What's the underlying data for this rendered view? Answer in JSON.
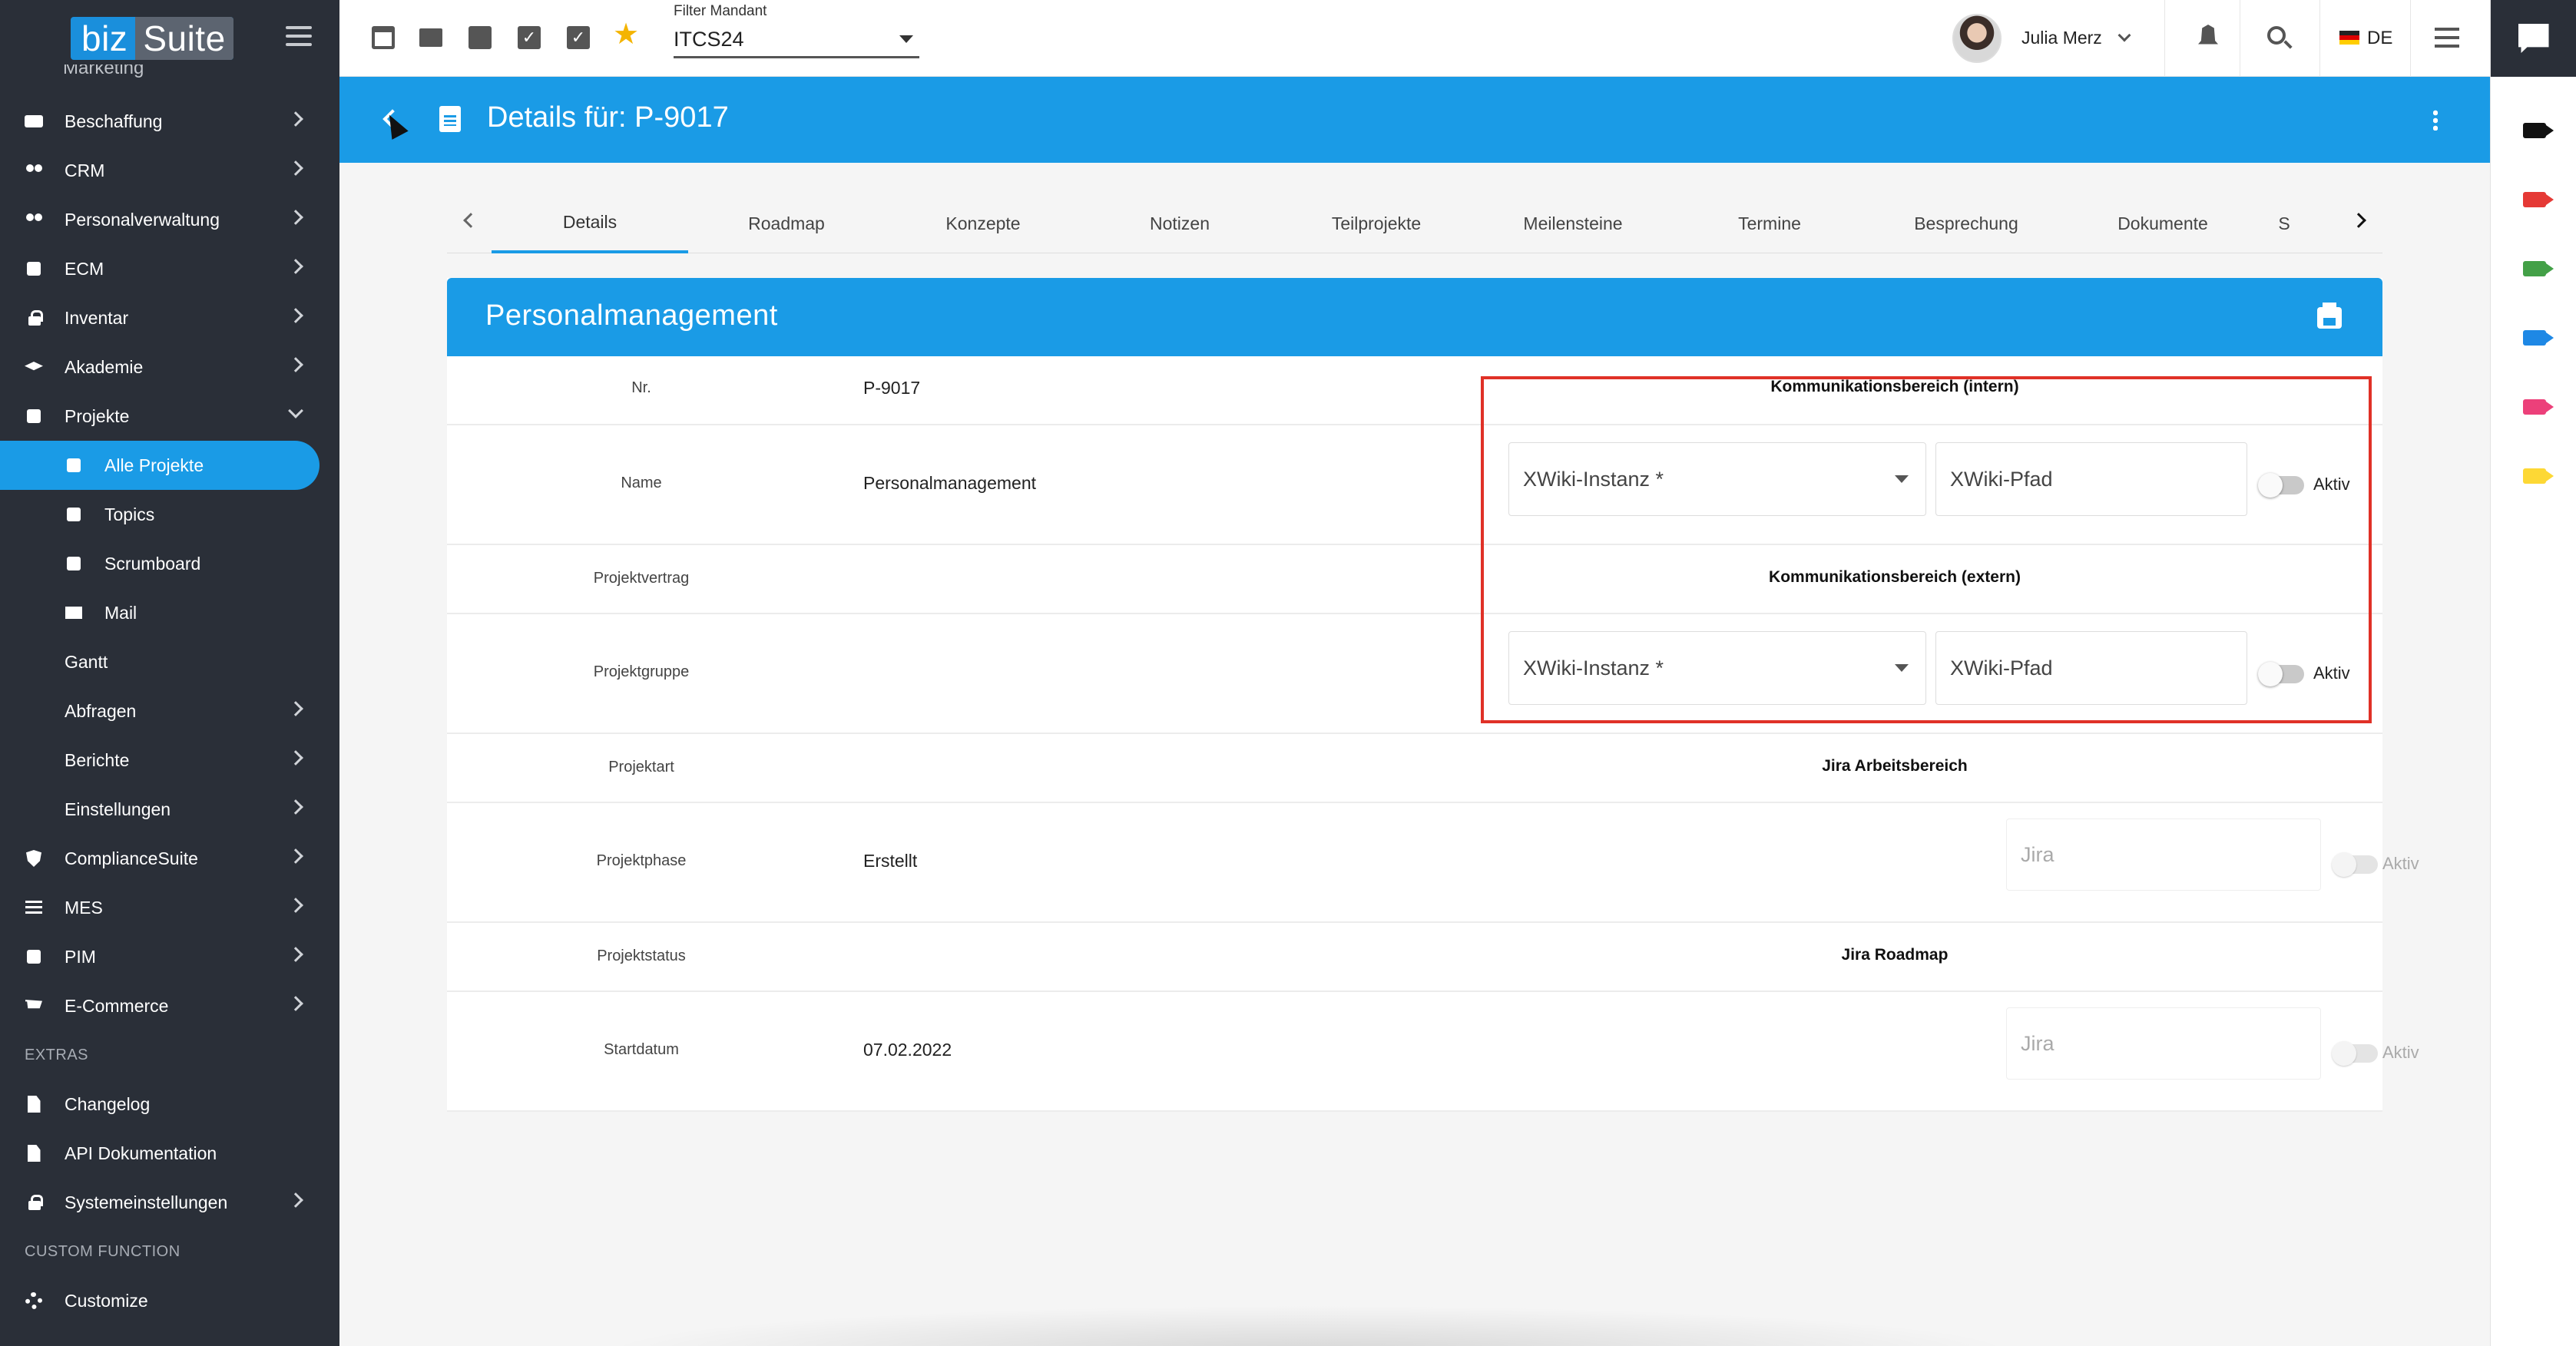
{
  "app": {
    "logo_part1": "biz",
    "logo_part2": "Suite"
  },
  "sidebar": {
    "cut_item": "Marketing",
    "items": [
      {
        "label": "Beschaffung",
        "icon": "truck-icon",
        "chevron": "right"
      },
      {
        "label": "CRM",
        "icon": "people-icon",
        "chevron": "right"
      },
      {
        "label": "Personalverwaltung",
        "icon": "people-icon",
        "chevron": "right"
      },
      {
        "label": "ECM",
        "icon": "archive-icon",
        "chevron": "right"
      },
      {
        "label": "Inventar",
        "icon": "lock-icon",
        "chevron": "right"
      },
      {
        "label": "Akademie",
        "icon": "graduation-cap-icon",
        "chevron": "right"
      },
      {
        "label": "Projekte",
        "icon": "chart-icon",
        "chevron": "down"
      }
    ],
    "projekte_sub": [
      {
        "label": "Alle Projekte",
        "active": true
      },
      {
        "label": "Topics"
      },
      {
        "label": "Scrumboard"
      },
      {
        "label": "Mail"
      }
    ],
    "projekte_plain": [
      {
        "label": "Gantt",
        "chevron": ""
      },
      {
        "label": "Abfragen",
        "chevron": "right"
      },
      {
        "label": "Berichte",
        "chevron": "right"
      },
      {
        "label": "Einstellungen",
        "chevron": "right"
      }
    ],
    "items2": [
      {
        "label": "ComplianceSuite",
        "icon": "shield-icon"
      },
      {
        "label": "MES",
        "icon": "sliders-icon"
      },
      {
        "label": "PIM",
        "icon": "table-icon"
      },
      {
        "label": "E-Commerce",
        "icon": "cart-icon"
      }
    ],
    "extras_heading": "EXTRAS",
    "extras": [
      {
        "label": "Changelog"
      },
      {
        "label": "API Dokumentation"
      },
      {
        "label": "Systemeinstellungen"
      }
    ],
    "custom_heading": "CUSTOM FUNCTION",
    "custom": {
      "label": "Customize"
    }
  },
  "topbar": {
    "filter_label": "Filter Mandant",
    "filter_value": "ITCS24",
    "user_name": "Julia Merz",
    "language": "DE"
  },
  "header": {
    "title": "Details für: P-9017"
  },
  "tabs": [
    "Details",
    "Roadmap",
    "Konzepte",
    "Notizen",
    "Teilprojekte",
    "Meilensteine",
    "Termine",
    "Besprechung",
    "Dokumente",
    "S"
  ],
  "active_tab": "Details",
  "card": {
    "title": "Personalmanagement",
    "rows": [
      {
        "label": "Nr.",
        "value": "P-9017"
      },
      {
        "label": "Name",
        "value": "Personalmanagement"
      },
      {
        "label": "Projektvertrag",
        "value": ""
      },
      {
        "label": "Projektgruppe",
        "value": ""
      },
      {
        "label": "Projektart",
        "value": ""
      },
      {
        "label": "Projektphase",
        "value": "Erstellt"
      },
      {
        "label": "Projektstatus",
        "value": ""
      },
      {
        "label": "Startdatum",
        "value": "07.02.2022"
      }
    ],
    "right": {
      "intern_heading": "Kommunikationsbereich (intern)",
      "extern_heading": "Kommunikationsbereich (extern)",
      "xwiki_instance_placeholder": "XWiki-Instanz *",
      "xwiki_path_placeholder": "XWiki-Pfad",
      "aktiv": "Aktiv",
      "jira_heading": "Jira Arbeitsbereich",
      "jira_roadmap_heading": "Jira Roadmap",
      "jira_placeholder": "Jira"
    }
  },
  "colors": {
    "primary": "#1a9be6",
    "sidebar": "#2a2f38",
    "highlight": "#e03127",
    "star": "#f4b400"
  },
  "rightrail": {
    "icons": [
      "black-video-icon",
      "red-video-icon",
      "green-video-icon",
      "blue-video-icon",
      "pink-video-icon",
      "yellow-video-icon"
    ]
  }
}
